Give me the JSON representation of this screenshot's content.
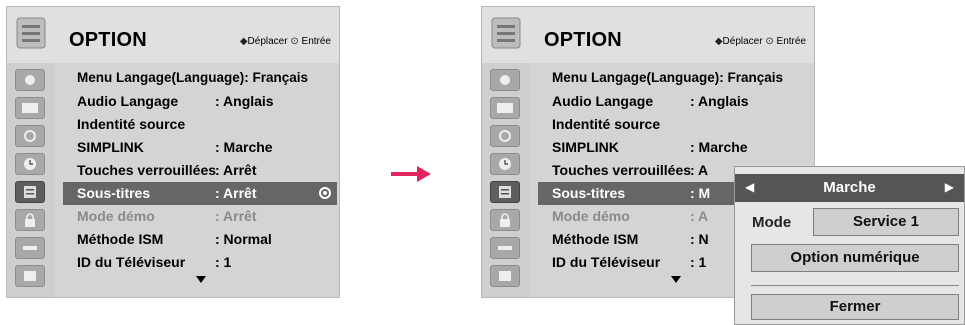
{
  "left_panel": {
    "title": "OPTION",
    "nav_hint": {
      "move": "Déplacer",
      "enter": "Entrée"
    },
    "rows": [
      {
        "label": "Menu Langage(Language): Français",
        "value": ""
      },
      {
        "label": "Audio Langage",
        "value": ": Anglais"
      },
      {
        "label": "Indentité source",
        "value": ""
      },
      {
        "label": "SIMPLINK",
        "value": ": Marche"
      },
      {
        "label": "Touches verrouillées",
        "value": ": Arrêt"
      },
      {
        "label": "Sous-titres",
        "value": ": Arrêt"
      },
      {
        "label": "Mode démo",
        "value": ": Arrêt"
      },
      {
        "label": "Méthode ISM",
        "value": ": Normal"
      },
      {
        "label": "ID du Téléviseur",
        "value": ": 1"
      }
    ]
  },
  "right_panel": {
    "title": "OPTION",
    "nav_hint": {
      "move": "Déplacer",
      "enter": "Entrée"
    },
    "rows": [
      {
        "label": "Menu Langage(Language): Français",
        "value": ""
      },
      {
        "label": "Audio Langage",
        "value": ": Anglais"
      },
      {
        "label": "Indentité source",
        "value": ""
      },
      {
        "label": "SIMPLINK",
        "value": ": Marche"
      },
      {
        "label": "Touches verrouillées",
        "value": ": A"
      },
      {
        "label": "Sous-titres",
        "value": ": M"
      },
      {
        "label": "Mode démo",
        "value": ": A"
      },
      {
        "label": "Méthode ISM",
        "value": ": N"
      },
      {
        "label": "ID du Téléviseur",
        "value": ": 1"
      }
    ]
  },
  "popup": {
    "selector_value": "Marche",
    "mode_label": "Mode",
    "mode_value": "Service 1",
    "option_button": "Option numérique",
    "close_button": "Fermer"
  },
  "side_icons": [
    "antenna-icon",
    "picture-icon",
    "audio-icon",
    "clock-icon",
    "option-icon",
    "lock-icon",
    "input-icon",
    "usb-icon"
  ],
  "colors": {
    "panel_bg": "#d4d4d4",
    "selected_row": "#666666",
    "popup_header": "#555555",
    "arrow": "#e0245e"
  }
}
